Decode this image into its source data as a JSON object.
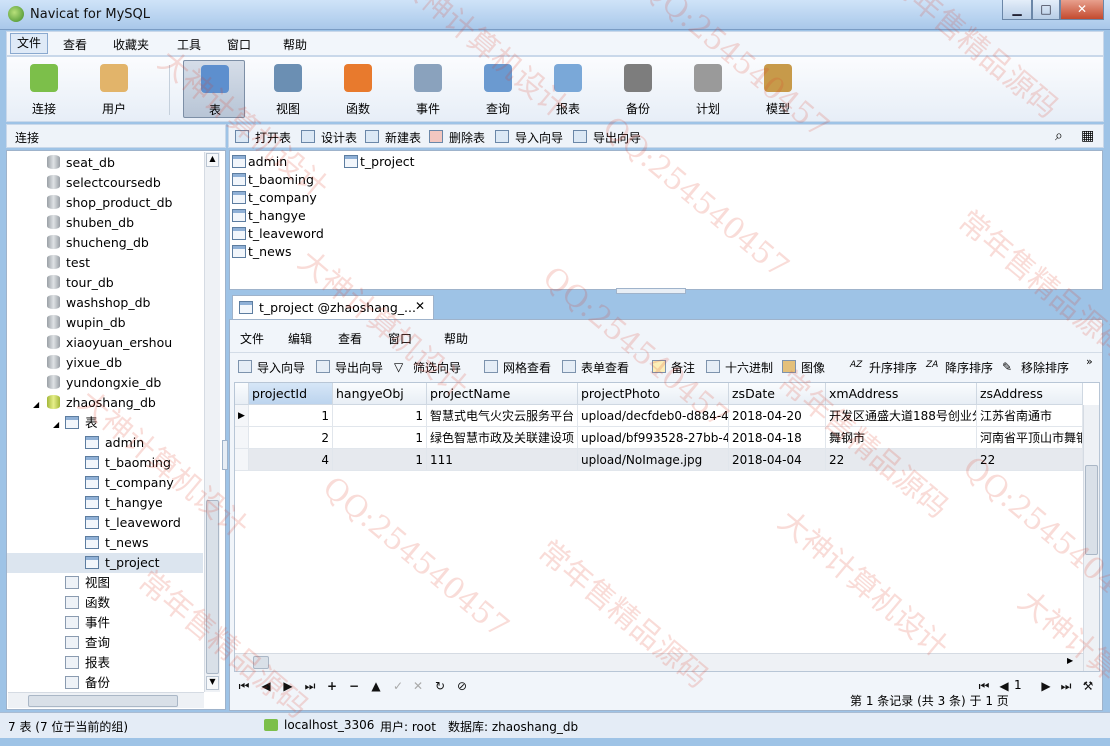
{
  "window": {
    "title": "Navicat for MySQL",
    "min": "▁",
    "max": "□",
    "close": "✕"
  },
  "menu": [
    "文件",
    "查看",
    "收藏夹",
    "工具",
    "窗口",
    "帮助"
  ],
  "toolbar": [
    {
      "label": "连接",
      "icon": "plug-icon",
      "color": "#7cbf4a"
    },
    {
      "label": "用户",
      "icon": "user-icon",
      "color": "#e2b46a"
    },
    {
      "label": "表",
      "icon": "table-icon",
      "color": "#5d8fce"
    },
    {
      "label": "视图",
      "icon": "glasses-icon",
      "color": "#6b8fb3"
    },
    {
      "label": "函数",
      "icon": "function-icon",
      "color": "#e87a2d"
    },
    {
      "label": "事件",
      "icon": "clock-icon",
      "color": "#8aa2bd"
    },
    {
      "label": "查询",
      "icon": "query-icon",
      "color": "#6b9ad0"
    },
    {
      "label": "报表",
      "icon": "report-icon",
      "color": "#7aa8d8"
    },
    {
      "label": "备份",
      "icon": "backup-icon",
      "color": "#7d7d7d"
    },
    {
      "label": "计划",
      "icon": "calendar-icon",
      "color": "#9a9a9a"
    },
    {
      "label": "模型",
      "icon": "model-icon",
      "color": "#c79a4a"
    }
  ],
  "connbar": {
    "label": "连接"
  },
  "objbar": [
    "打开表",
    "设计表",
    "新建表",
    "删除表",
    "导入向导",
    "导出向导"
  ],
  "tree": {
    "dbs": [
      "seat_db",
      "selectcoursedb",
      "shop_product_db",
      "shuben_db",
      "shucheng_db",
      "test",
      "tour_db",
      "washshop_db",
      "wupin_db",
      "xiaoyuan_ershou",
      "yixue_db",
      "yundongxie_db",
      "zhaoshang_db"
    ],
    "tables_label": "表",
    "tables": [
      "admin",
      "t_baoming",
      "t_company",
      "t_hangye",
      "t_leaveword",
      "t_news",
      "t_project"
    ],
    "others": [
      "视图",
      "函数",
      "事件",
      "查询",
      "报表",
      "备份"
    ]
  },
  "objlist": [
    "admin",
    "t_baoming",
    "t_company",
    "t_hangye",
    "t_leaveword",
    "t_news",
    "t_project"
  ],
  "tab": {
    "label": "t_project @zhaoshang_...",
    "close": "✕"
  },
  "innermenu": [
    "文件",
    "编辑",
    "查看",
    "窗口",
    "帮助"
  ],
  "innerbar": [
    "导入向导",
    "导出向导",
    "筛选向导",
    "网格查看",
    "表单查看",
    "备注",
    "十六进制",
    "图像",
    "升序排序",
    "降序排序",
    "移除排序"
  ],
  "grid": {
    "columns": [
      "projectId",
      "hangyeObj",
      "projectName",
      "projectPhoto",
      "zsDate",
      "xmAddress",
      "zsAddress"
    ],
    "rows": [
      [
        "1",
        "1",
        "智慧式电气火灾云服务平台",
        "upload/decfdeb0-d884-4",
        "2018-04-20",
        "开发区通盛大道188号创业分",
        "江苏省南通市"
      ],
      [
        "2",
        "1",
        "绿色智慧市政及关联建设项",
        "upload/bf993528-27bb-4",
        "2018-04-18",
        "舞钢市",
        "河南省平顶山市舞钢"
      ],
      [
        "4",
        "1",
        "111",
        "upload/NoImage.jpg",
        "2018-04-04",
        "22",
        "22"
      ]
    ]
  },
  "nav": {
    "page": "1",
    "info": "第 1 条记录 (共 3 条) 于 1 页"
  },
  "status": {
    "left": "7 表 (7 位于当前的组)",
    "host": "localhost_3306",
    "user": "用户: root",
    "db": "数据库: zhaoshang_db"
  },
  "watermarks": [
    "大神计算机设计",
    "QQ:254540457",
    "常年售精品源码"
  ]
}
